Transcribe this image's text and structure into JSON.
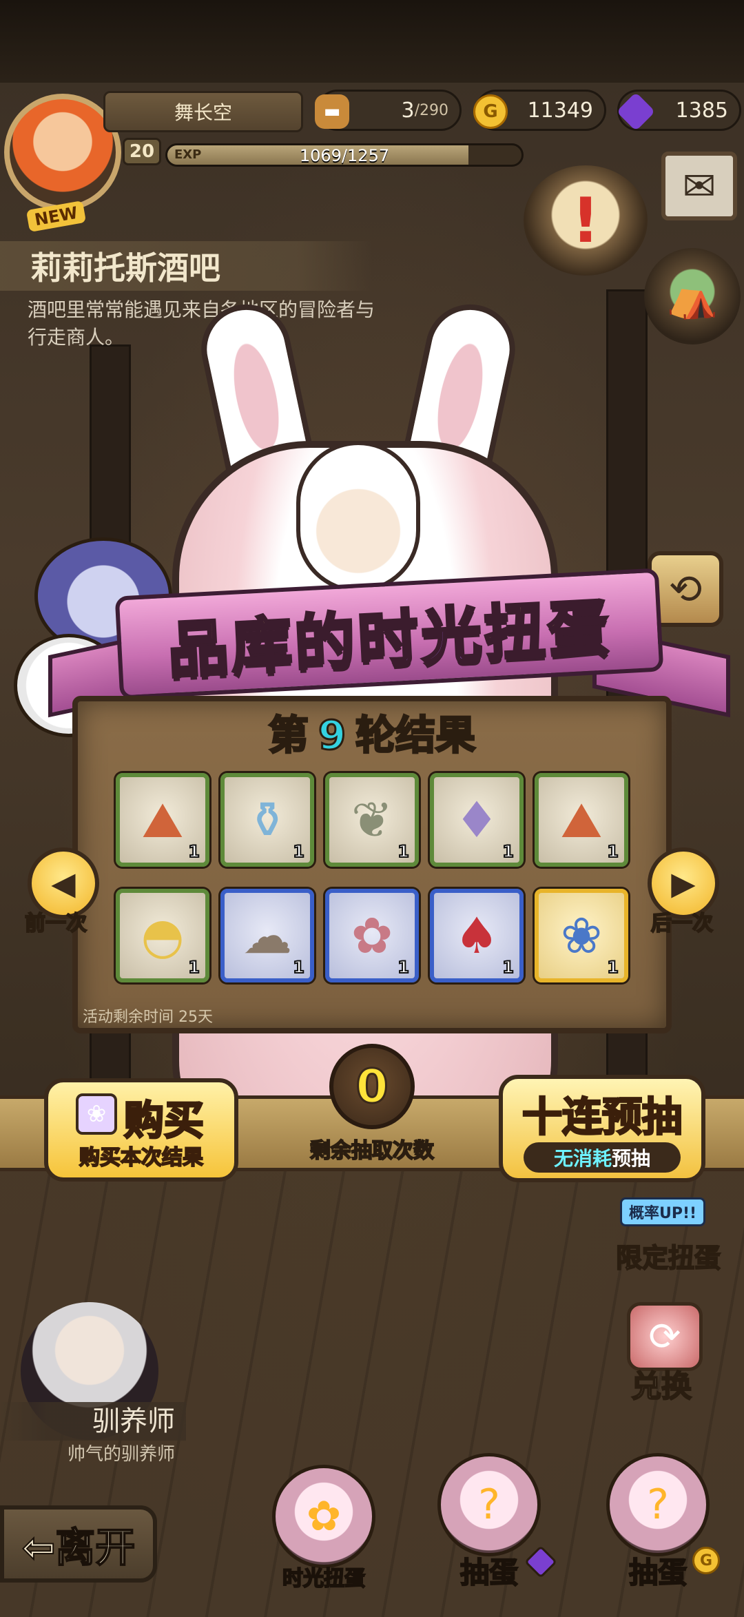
{
  "player": {
    "name": "舞长空",
    "level": "20",
    "exp_label": "EXP",
    "exp_text": "1069/1257",
    "exp_fraction": 0.85,
    "new_badge": "NEW"
  },
  "resources": {
    "stamina_current": "3",
    "stamina_max": "/290",
    "gold": "11349",
    "gold_icon": "G",
    "gems": "1385"
  },
  "location": {
    "title": "莉莉托斯酒吧",
    "description": "酒吧里常常能遇见来自各地区的冒险者与行走商人。"
  },
  "banner": {
    "title_a": "品库的",
    "title_b": "时光",
    "title_c": "扭蛋"
  },
  "results": {
    "round_prefix": "第",
    "round_number": "9",
    "round_suffix": "轮结果",
    "time_left": "活动剩余时间  25天",
    "items": [
      {
        "icon": "fire-ore-icon",
        "glyph": "⛰",
        "color": "#d0643a",
        "qty": "1",
        "rarity": "green"
      },
      {
        "icon": "potion-bottle-icon",
        "glyph": "⚱",
        "color": "#7fb4d8",
        "qty": "1",
        "rarity": "green"
      },
      {
        "icon": "leaf-icon",
        "glyph": "❦",
        "color": "#8a8f76",
        "qty": "1",
        "rarity": "green"
      },
      {
        "icon": "purple-crystal-icon",
        "glyph": "♦",
        "color": "#9a86c9",
        "qty": "1",
        "rarity": "green"
      },
      {
        "icon": "fire-ore-icon",
        "glyph": "⛰",
        "color": "#d0643a",
        "qty": "1",
        "rarity": "green"
      },
      {
        "icon": "moon-helmet-icon",
        "glyph": "◓",
        "color": "#e8c24a",
        "qty": "1",
        "rarity": "green"
      },
      {
        "icon": "sheep-pet-icon",
        "glyph": "☁",
        "color": "#8a7a6a",
        "qty": "1",
        "rarity": "blue"
      },
      {
        "icon": "gift-sack-icon",
        "glyph": "✿",
        "color": "#c87a86",
        "qty": "1",
        "rarity": "blue"
      },
      {
        "icon": "red-helmet-icon",
        "glyph": "♠",
        "color": "#c8323a",
        "qty": "1",
        "rarity": "blue"
      },
      {
        "icon": "rabbit-pet-icon",
        "glyph": "❀",
        "color": "#4a78c8",
        "qty": "1",
        "rarity": "gold"
      }
    ]
  },
  "nav": {
    "prev_label": "前一次",
    "next_label": "后一次"
  },
  "actions": {
    "buy_label": "购买",
    "buy_sub": "购买本次结果",
    "draws_remaining": "0",
    "draws_label": "剩余抽取次数",
    "ten_label": "十连预抽",
    "ten_free": "无消耗",
    "ten_pre": "预抽"
  },
  "side": {
    "limited_rate": "概率UP!!",
    "limited_label": "限定扭蛋",
    "exchange_label": "兑换"
  },
  "npc": {
    "name": "驯养师",
    "title": "帅气的驯养师"
  },
  "bottom": {
    "leave_label": "⇦离开",
    "time_gacha_label": "时光扭蛋",
    "gacha_gem_label": "抽蛋",
    "gacha_gold_label": "抽蛋",
    "gold_icon": "G"
  }
}
